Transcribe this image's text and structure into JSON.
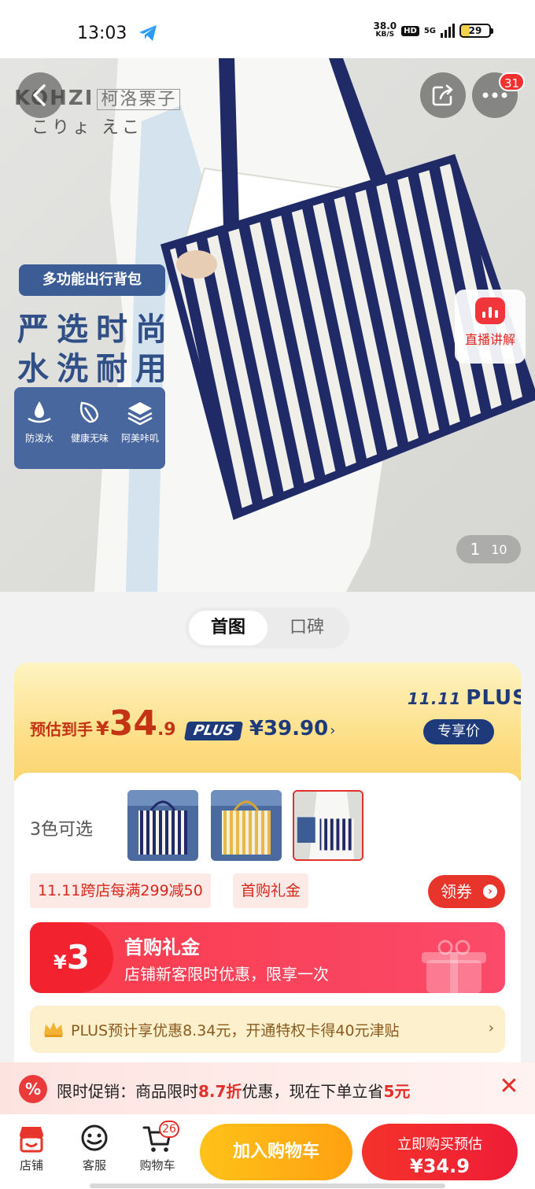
{
  "status_bar": {
    "time": "13:03",
    "net_speed": "38.0",
    "net_unit": "KB/S",
    "hd": "HD",
    "signal": "5G",
    "battery": "29"
  },
  "hero": {
    "brand_en": "KOHZI",
    "brand_cn": "柯洛栗子",
    "brand_jp": "こりょ  えこ",
    "tag": "多功能出行背包",
    "slogan_1": "严选时尚",
    "slogan_2": "水洗耐用",
    "features": [
      {
        "icon": "water-drop-icon",
        "label": "防泼水"
      },
      {
        "icon": "leaf-icon",
        "label": "健康无味"
      },
      {
        "icon": "layers-icon",
        "label": "阿美咔叽"
      }
    ],
    "more_badge": "31",
    "live_label": "直播讲解",
    "pager_current": "1",
    "pager_total": "10"
  },
  "tabs": [
    {
      "label": "首图",
      "active": true
    },
    {
      "label": "口碑",
      "active": false
    }
  ],
  "price": {
    "est_label": "预估到手",
    "currency": "¥",
    "int": "34",
    "dec": ".9",
    "plus_badge": "PLUS",
    "plus_price": "¥39.90",
    "plus_arrow": "›",
    "logo_event": "11.11",
    "logo_plus": "PLUS",
    "exclusive": "专享价"
  },
  "colors": {
    "label": "3色可选"
  },
  "coupons": {
    "tag_1": "11.11跨店每满299减50",
    "tag_2": "首购礼金",
    "get_button": "领券",
    "get_arrow": "›"
  },
  "gift": {
    "currency": "¥",
    "amount": "3",
    "title": "首购礼金",
    "desc": "店铺新客限时优惠，限享一次"
  },
  "plus_bar": {
    "text": "PLUS预计享优惠8.34元，开通特权卡得40元津贴",
    "arrow": "›"
  },
  "promo": {
    "icon": "%",
    "prefix": "限时促销：商品限时",
    "discount": "8.7折",
    "middle": "优惠，现在下单立省",
    "save": "5元",
    "close": "✕"
  },
  "bottom_nav": {
    "shop": "店铺",
    "service": "客服",
    "cart": "购物车",
    "cart_count": "26",
    "add_cart": "加入购物车",
    "buy_label": "立即购买预估",
    "buy_price": "¥34.9"
  },
  "theme": {
    "accent_red": "#e8352b",
    "plus_navy": "#1f3a7a",
    "promo_yellow": "#ffb415"
  }
}
